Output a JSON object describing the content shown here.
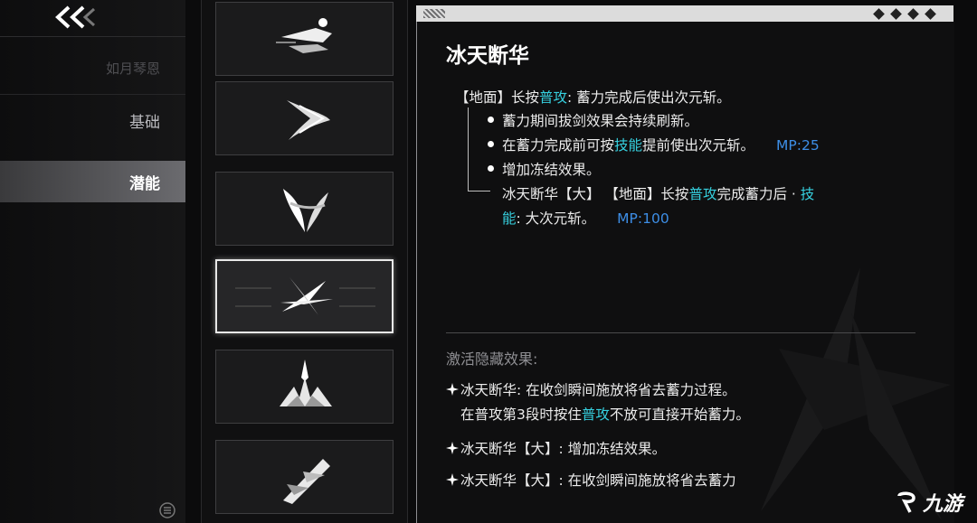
{
  "sidebar": {
    "items": [
      {
        "label": "如月琴恩",
        "state": "faded"
      },
      {
        "label": "基础",
        "state": "normal"
      },
      {
        "label": "潜能",
        "state": "active"
      }
    ]
  },
  "skill_cards": [
    {
      "icon": "dash-runner-icon",
      "selected": false
    },
    {
      "icon": "sweep-wave-icon",
      "selected": false
    },
    {
      "icon": "wing-slash-icon",
      "selected": false
    },
    {
      "icon": "cross-slash-icon",
      "selected": true
    },
    {
      "icon": "ice-burst-icon",
      "selected": false
    },
    {
      "icon": "drill-sword-icon",
      "selected": false
    }
  ],
  "detail": {
    "title": "冰天断华",
    "line1_prefix": "【地面】长按",
    "line1_hl": "普攻",
    "line1_suffix": ": 蓄力完成后使出次元斩。",
    "b1": "蓄力期间拔剑效果会持续刷新。",
    "b2_prefix": "在蓄力完成前可按",
    "b2_hl": "技能",
    "b2_suffix": "提前使出次元斩。",
    "b2_mp": "MP:25",
    "b3": "增加冻结效果。",
    "b4_prefix": "冰天断华【大】 【地面】长按",
    "b4_hl1": "普攻",
    "b4_mid": "完成蓄力后 · ",
    "b4_hl2a": "技",
    "b4_hl2b": "能",
    "b4_suffix": ": 大次元斩。",
    "b4_mp": "MP:100"
  },
  "hidden": {
    "header": "激活隐藏效果:",
    "e1_line1": "冰天断华: 在收剑瞬间施放将省去蓄力过程。",
    "e1_line2_prefix": "在普攻第3段时按住",
    "e1_line2_hl": "普攻",
    "e1_line2_suffix": "不放可直接开始蓄力。",
    "e2": "冰天断华【大】: 增加冻结效果。",
    "e3": "冰天断华【大】: 在收剑瞬间施放将省去蓄力"
  },
  "watermark": "九游",
  "colors": {
    "highlight": "#36d0df",
    "mp": "#3d8ee6",
    "active_nav": "#6b6b6f"
  }
}
